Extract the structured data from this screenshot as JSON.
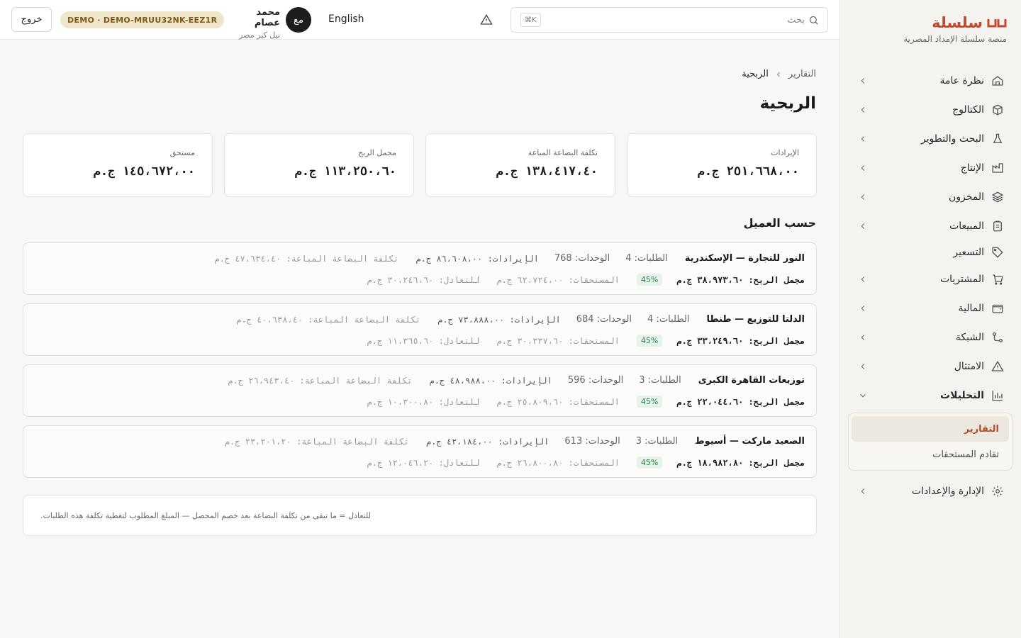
{
  "brand": {
    "name": "سلسلة",
    "subtitle": "منصة سلسلة الإمداد المصرية",
    "color": "#c0492b"
  },
  "sidebar": {
    "items": [
      {
        "label": "نظرة عامة",
        "icon": "home-icon",
        "has_chevron": true
      },
      {
        "label": "الكتالوج",
        "icon": "box-icon",
        "has_chevron": true
      },
      {
        "label": "البحث والتطوير",
        "icon": "flask-icon",
        "has_chevron": true
      },
      {
        "label": "الإنتاج",
        "icon": "factory-icon",
        "has_chevron": true
      },
      {
        "label": "المخزون",
        "icon": "layers-icon",
        "has_chevron": true
      },
      {
        "label": "المبيعات",
        "icon": "clipboard-icon",
        "has_chevron": true
      },
      {
        "label": "التسعير",
        "icon": "tag-icon",
        "has_chevron": false
      },
      {
        "label": "المشتريات",
        "icon": "cart-icon",
        "has_chevron": true
      },
      {
        "label": "المالية",
        "icon": "wallet-icon",
        "has_chevron": true
      },
      {
        "label": "الشبكة",
        "icon": "network-icon",
        "has_chevron": true
      },
      {
        "label": "الامتثال",
        "icon": "warning-icon",
        "has_chevron": true
      },
      {
        "label": "التحليلات",
        "icon": "bar-chart-icon",
        "has_chevron": true,
        "expanded": true
      }
    ],
    "subitems": [
      {
        "label": "التقارير",
        "active": true
      },
      {
        "label": "تقادم المستحقات",
        "active": false
      }
    ],
    "settings": {
      "label": "الإدارة والإعدادات",
      "icon": "gear-icon"
    }
  },
  "topbar": {
    "logout_label": "خروج",
    "demo_badge": "DEMO · DEMO-MRUU32NK-EEZ1R",
    "user_name": "محمد عصام",
    "user_org": "نيل كير مصر",
    "avatar_initials": "مع",
    "language": "English",
    "search_placeholder": "بحث",
    "search_shortcut": "⌘K"
  },
  "breadcrumb": {
    "parent": "التقارير",
    "current": "الربحية"
  },
  "page_title": "الربحية",
  "kpis": [
    {
      "label": "الإيرادات",
      "value": "٢٥١،٦٦٨،٠٠ ج.م"
    },
    {
      "label": "تكلفة البضاعة المباعة",
      "value": "١٣٨،٤١٧،٤٠ ج.م"
    },
    {
      "label": "مجمل الربح",
      "value": "١١٣،٢٥٠،٦٠ ج.م"
    },
    {
      "label": "مستحق",
      "value": "١٤٥،٦٧٢،٠٠ ج.م"
    }
  ],
  "section_title": "حسب العميل",
  "customers": [
    {
      "name": "النور للتجارة — الإسكندرية",
      "orders": "الطلبات: 4",
      "units": "الوحدات: 768",
      "revenue": "الإيرادات: ٨٦،٦٠٨،٠٠ ج.م",
      "cogs": "تكلفة البضاعة المباعة: ٤٧،٦٣٤،٤٠ ج.م",
      "gross_profit": "مجمل الربح: ٣٨،٩٧٣،٦٠ ج.م",
      "margin": "45%",
      "receivables": "المستحقات: ٦٢،٧٢٤،٠٠ ج.م",
      "breakeven": "للتعادل: ٣٠،٢٤٦،٦٠ ج.م"
    },
    {
      "name": "الدلتا للتوزيع — طنطا",
      "orders": "الطلبات: 4",
      "units": "الوحدات: 684",
      "revenue": "الإيرادات: ٧٣،٨٨٨،٠٠ ج.م",
      "cogs": "تكلفة البضاعة المباعة: ٤٠،٦٣٨،٤٠ ج.م",
      "gross_profit": "مجمل الربح: ٣٣،٢٤٩،٦٠ ج.م",
      "margin": "45%",
      "receivables": "المستحقات: ٣٠،٣٣٧،٦٠ ج.م",
      "breakeven": "للتعادل: ١١،٣٦٥،٦٠ ج.م"
    },
    {
      "name": "توزيعات القاهرة الكبرى",
      "orders": "الطلبات: 3",
      "units": "الوحدات: 596",
      "revenue": "الإيرادات: ٤٨،٩٨٨،٠٠ ج.م",
      "cogs": "تكلفة البضاعة المباعة: ٢٦،٩٤٣،٤٠ ج.م",
      "gross_profit": "مجمل الربح: ٢٢،٠٤٤،٦٠ ج.م",
      "margin": "45%",
      "receivables": "المستحقات: ٢٥،٨٠٩،٦٠ ج.م",
      "breakeven": "للتعادل: ١٠،٣٠٠،٨٠ ج.م"
    },
    {
      "name": "الصعيد ماركت — أسيوط",
      "orders": "الطلبات: 3",
      "units": "الوحدات: 613",
      "revenue": "الإيرادات: ٤٢،١٨٤،٠٠ ج.م",
      "cogs": "تكلفة البضاعة المباعة: ٢٣،٢٠١،٢٠ ج.م",
      "gross_profit": "مجمل الربح: ١٨،٩٨٢،٨٠ ج.م",
      "margin": "45%",
      "receivables": "المستحقات: ٢٦،٨٠٠،٨٠ ج.م",
      "breakeven": "للتعادل: ١٢،٠٤٦،٢٠ ج.م"
    }
  ],
  "note": "للتعادل = ما تبقى من تكلفة البضاعة بعد خصم المحصل — المبلغ المطلوب لتغطية تكلفة هذه الطلبات."
}
